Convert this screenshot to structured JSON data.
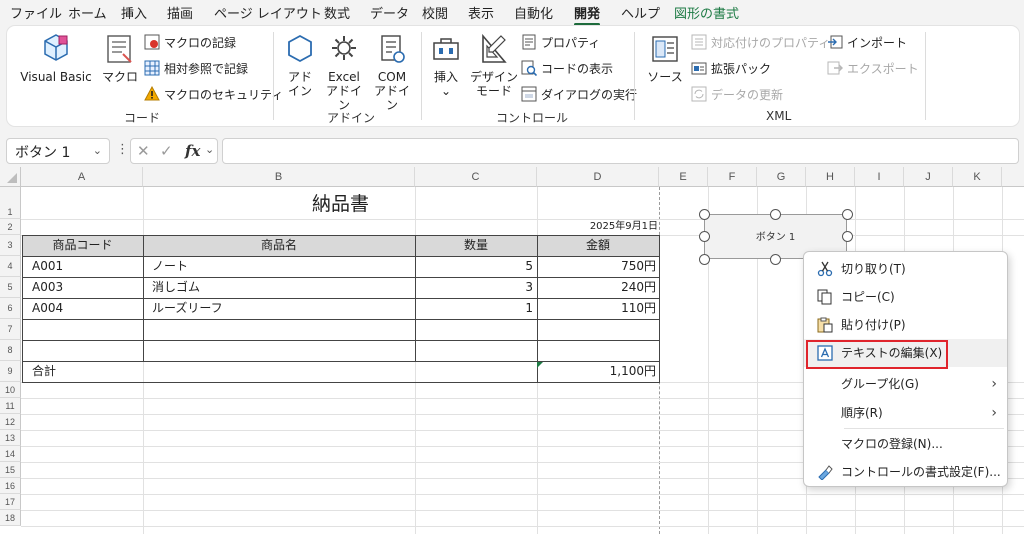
{
  "menu": {
    "tabs": [
      "ファイル",
      "ホーム",
      "挿入",
      "描画",
      "ページ レイアウト",
      "数式",
      "データ",
      "校閲",
      "表示",
      "自動化",
      "開発",
      "ヘルプ",
      "図形の書式"
    ],
    "active": "開発"
  },
  "ribbon": {
    "code": {
      "label": "コード",
      "visual_basic": "Visual Basic",
      "macro": "マクロ",
      "record_macro": "マクロの記録",
      "relative_ref": "相対参照で記録",
      "macro_security": "マクロのセキュリティ"
    },
    "addins": {
      "label": "アドイン",
      "addin_line1": "アド",
      "addin_line2": "イン",
      "excel_line1": "Excel",
      "excel_line2": "アドイン",
      "com_line1": "COM",
      "com_line2": "アドイン"
    },
    "controls": {
      "label": "コントロール",
      "insert": "挿入",
      "insert_arrow": "⌄",
      "design_line1": "デザイン",
      "design_line2": "モード",
      "properties": "プロパティ",
      "view_code": "コードの表示",
      "run_dialog": "ダイアログの実行"
    },
    "xml": {
      "label": "XML",
      "source": "ソース",
      "map_props": "対応付けのプロパティ",
      "expansion": "拡張パック",
      "refresh": "データの更新",
      "import": "インポート",
      "export": "エクスポート"
    }
  },
  "formula_bar": {
    "name_box": "ボタン 1",
    "chevron": "⌄",
    "more": "⋮",
    "cancel": "✕",
    "enter": "✓",
    "fx": "fx",
    "fx_chevron": "⌄",
    "value": ""
  },
  "sheet": {
    "columns": [
      "A",
      "B",
      "C",
      "D",
      "E",
      "F",
      "G",
      "H",
      "I",
      "J",
      "K"
    ],
    "rows": [
      "1",
      "2",
      "3",
      "4",
      "5",
      "6",
      "7",
      "8",
      "9",
      "10",
      "11",
      "12",
      "13",
      "14",
      "15",
      "16",
      "17",
      "18"
    ],
    "title": "納品書",
    "date": "2025年9月1日",
    "headers": [
      "商品コード",
      "商品名",
      "数量",
      "金額"
    ],
    "items": [
      {
        "code": "A001",
        "name": "ノート",
        "qty": "5",
        "amount": "750円"
      },
      {
        "code": "A003",
        "name": "消しゴム",
        "qty": "3",
        "amount": "240円"
      },
      {
        "code": "A004",
        "name": "ルーズリーフ",
        "qty": "1",
        "amount": "110円"
      }
    ],
    "total_label": "合計",
    "total_value": "1,100円"
  },
  "shape_button": {
    "label": "ボタン 1"
  },
  "context_menu": {
    "items": [
      {
        "label": "切り取り(T)",
        "icon": "scissors-icon"
      },
      {
        "label": "コピー(C)",
        "icon": "copy-icon"
      },
      {
        "label": "貼り付け(P)",
        "icon": "paste-icon"
      },
      {
        "label": "テキストの編集(X)",
        "icon": "edit-text-icon"
      },
      {
        "label": "グループ化(G)",
        "icon": "",
        "submenu": true
      },
      {
        "label": "順序(R)",
        "icon": "",
        "submenu": true
      },
      {
        "label": "マクロの登録(N)...",
        "icon": ""
      },
      {
        "label": "コントロールの書式設定(F)...",
        "icon": "format-control-icon"
      }
    ],
    "submenu_arrow": "›",
    "highlighted": "テキストの編集(X)"
  },
  "colors": {
    "accent_green": "#1e6b3c",
    "highlight_red": "#e0242c",
    "header_fill": "#d9d9d9"
  }
}
